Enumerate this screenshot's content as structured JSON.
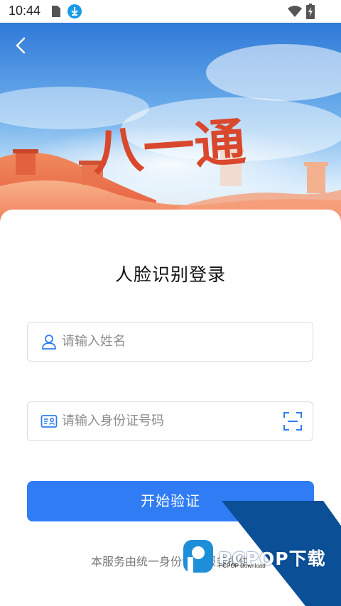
{
  "status_bar": {
    "time": "10:44",
    "icons": [
      "sim-card-icon",
      "download-icon",
      "wifi-icon",
      "battery-charging-icon"
    ]
  },
  "banner": {
    "logo_text": "八一通",
    "back_icon": "chevron-left-icon"
  },
  "login": {
    "title": "人脸识别登录",
    "name_field": {
      "icon": "user-icon",
      "placeholder": "请输入姓名",
      "value": ""
    },
    "id_field": {
      "icon": "id-card-icon",
      "placeholder": "请输入身份证号码",
      "value": "",
      "scan_icon": "scan-icon"
    },
    "submit_label": "开始验证",
    "footer_note": "本服务由统一身份认证服务提供"
  },
  "watermark": {
    "text": "PCPOP下载",
    "subtext": "PCPOP Download"
  },
  "colors": {
    "primary": "#2f7cf5",
    "icon_blue": "#2f7cf5",
    "text_dark": "#111111",
    "placeholder": "#8d8d8d",
    "watermark_blue": "#0b4f97"
  }
}
